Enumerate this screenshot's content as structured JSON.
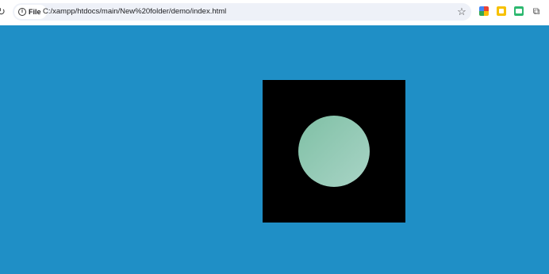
{
  "browser": {
    "security_chip_label": "File",
    "url": "C:/xampp/htdocs/main/New%20folder/demo/index.html",
    "icons": {
      "reload": "reload-icon",
      "info": "info-icon",
      "bookmark": "star-icon",
      "extension_1": "google-extension-icon",
      "extension_2": "notes-extension-icon",
      "extension_3": "screen-extension-icon",
      "extensions_menu": "puzzle-icon"
    }
  },
  "page": {
    "background_color": "#1f8fc6",
    "square_color": "#000000",
    "circle_gradient": [
      "#7fc0a5",
      "#a9d4c6"
    ]
  }
}
